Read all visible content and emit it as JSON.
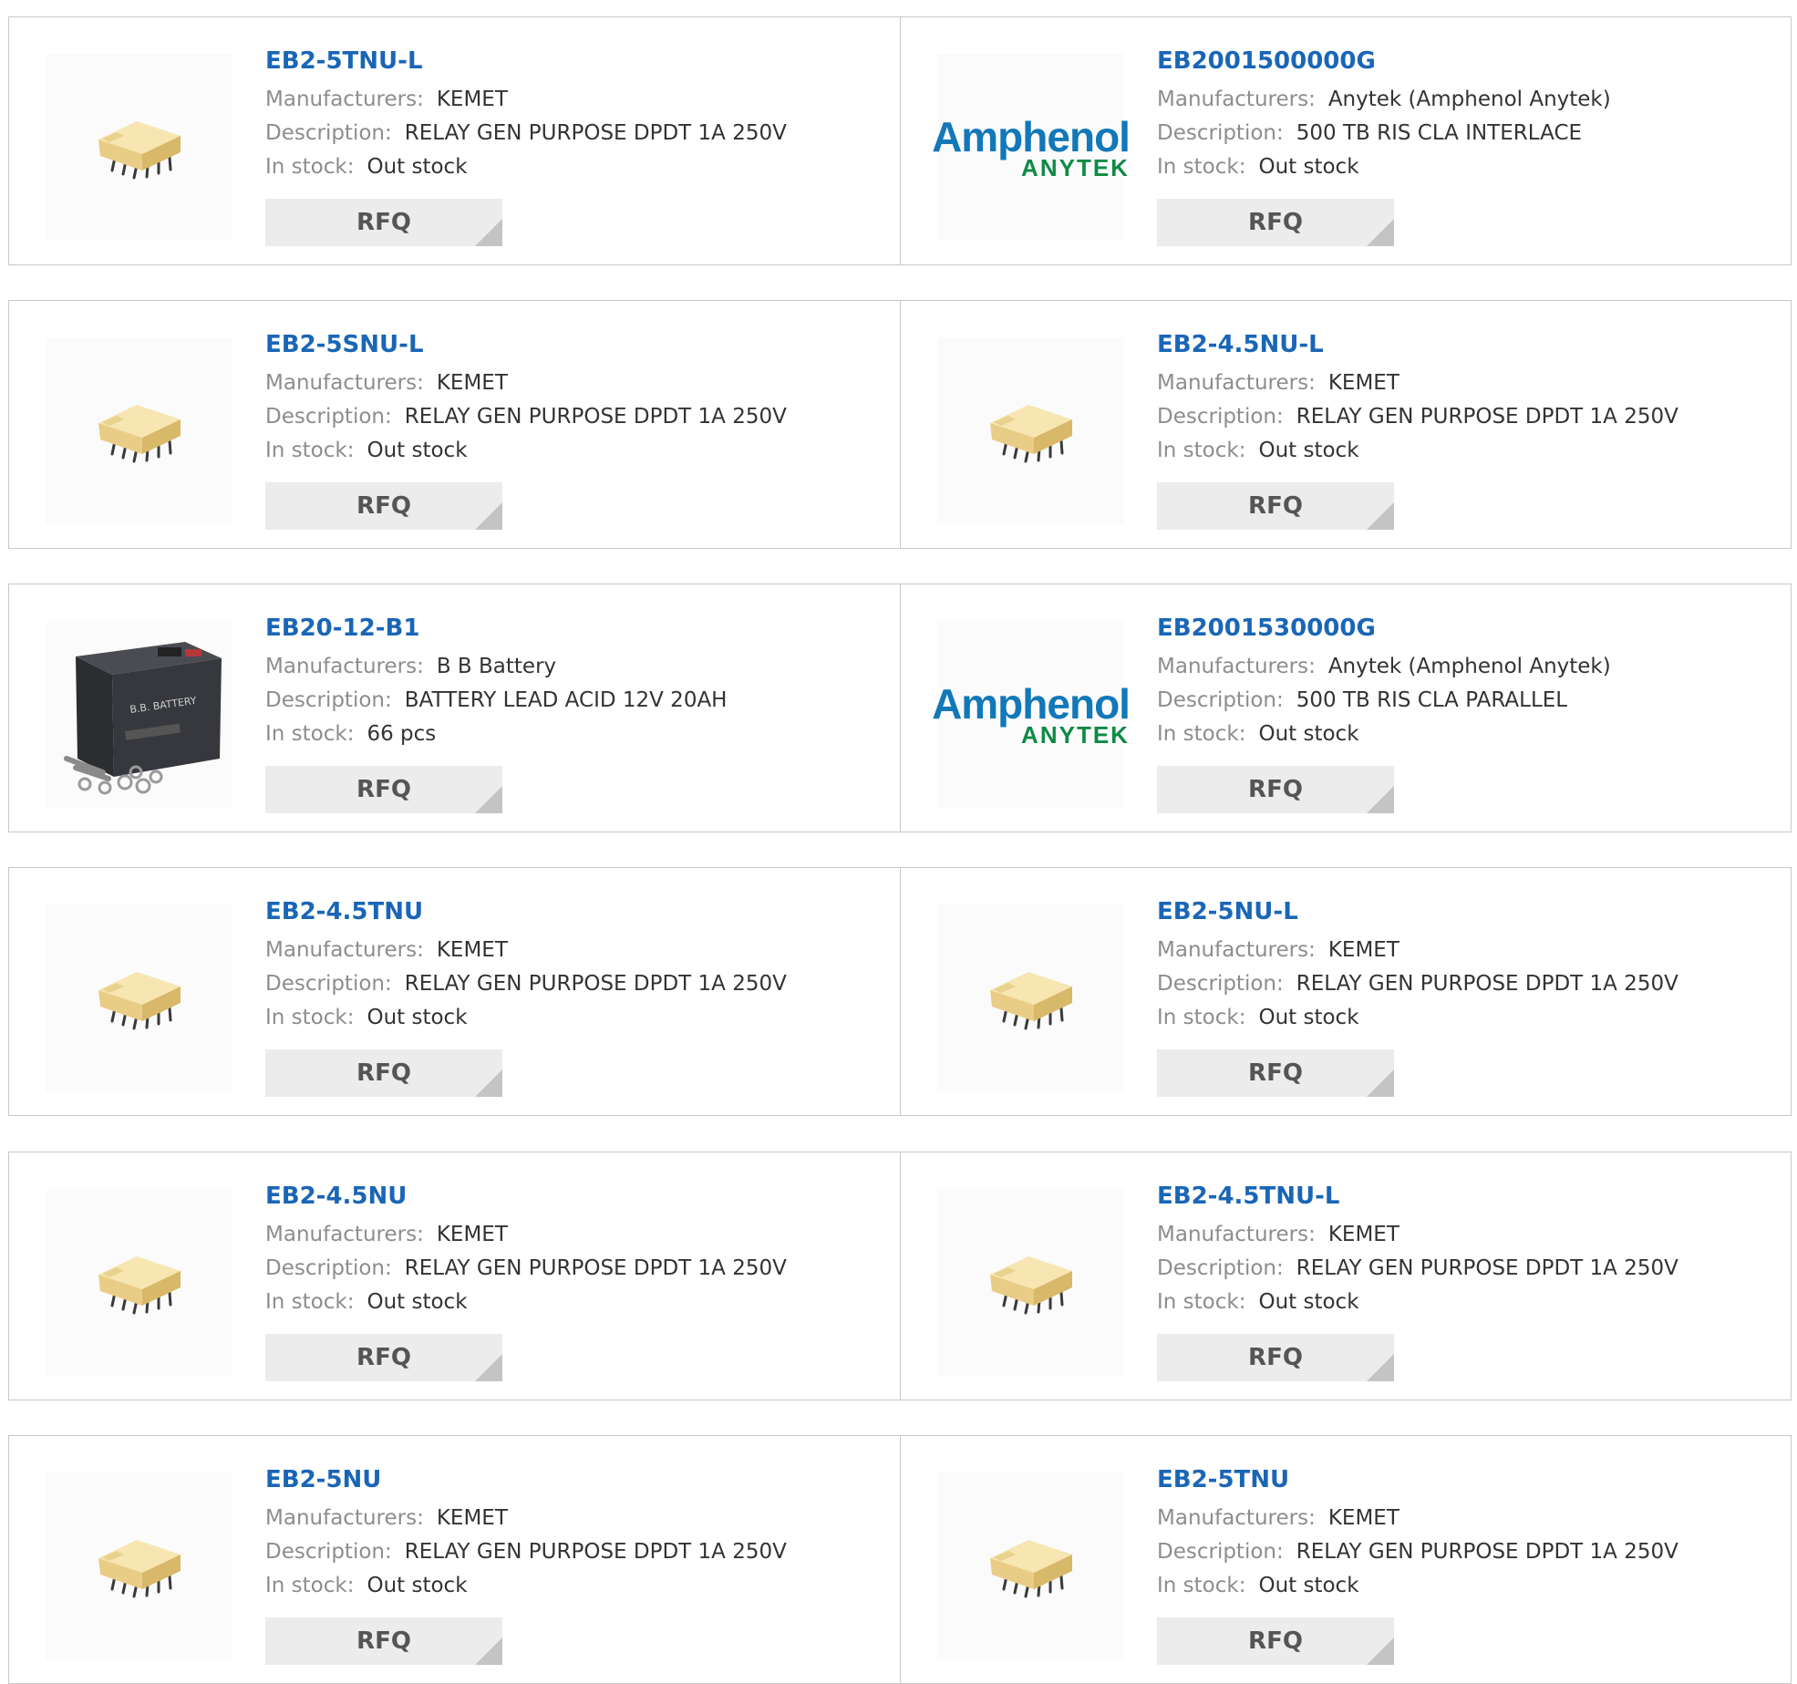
{
  "labels": {
    "manufacturer": "Manufacturers:",
    "description": "Description:",
    "stock": "In stock:",
    "rfq": "RFQ"
  },
  "brand": {
    "line1": "Amphenol",
    "line2": "ANYTEK"
  },
  "colors": {
    "link": "#1a66b6",
    "label": "#8d8d8d",
    "logo_blue": "#1278b8",
    "logo_green": "#0e8a45"
  },
  "products": [
    {
      "part": "EB2-5TNU-L",
      "manufacturer": "KEMET",
      "description": "RELAY GEN PURPOSE DPDT 1A 250V",
      "stock": "Out stock",
      "image": "relay-icon"
    },
    {
      "part": "EB2001500000G",
      "manufacturer": "Anytek (Amphenol Anytek)",
      "description": "500 TB RIS CLA INTERLACE",
      "stock": "Out stock",
      "image": "amphenol-logo"
    },
    {
      "part": "EB2-5SNU-L",
      "manufacturer": "KEMET",
      "description": "RELAY GEN PURPOSE DPDT 1A 250V",
      "stock": "Out stock",
      "image": "relay-icon"
    },
    {
      "part": "EB2-4.5NU-L",
      "manufacturer": "KEMET",
      "description": "RELAY GEN PURPOSE DPDT 1A 250V",
      "stock": "Out stock",
      "image": "relay-icon"
    },
    {
      "part": "EB20-12-B1",
      "manufacturer": "B B Battery",
      "description": "BATTERY LEAD ACID 12V 20AH",
      "stock": "66 pcs",
      "image": "battery-icon"
    },
    {
      "part": "EB2001530000G",
      "manufacturer": "Anytek (Amphenol Anytek)",
      "description": "500 TB RIS CLA PARALLEL",
      "stock": "Out stock",
      "image": "amphenol-logo"
    },
    {
      "part": "EB2-4.5TNU",
      "manufacturer": "KEMET",
      "description": "RELAY GEN PURPOSE DPDT 1A 250V",
      "stock": "Out stock",
      "image": "relay-icon"
    },
    {
      "part": "EB2-5NU-L",
      "manufacturer": "KEMET",
      "description": "RELAY GEN PURPOSE DPDT 1A 250V",
      "stock": "Out stock",
      "image": "relay-icon"
    },
    {
      "part": "EB2-4.5NU",
      "manufacturer": "KEMET",
      "description": "RELAY GEN PURPOSE DPDT 1A 250V",
      "stock": "Out stock",
      "image": "relay-icon"
    },
    {
      "part": "EB2-4.5TNU-L",
      "manufacturer": "KEMET",
      "description": "RELAY GEN PURPOSE DPDT 1A 250V",
      "stock": "Out stock",
      "image": "relay-icon"
    },
    {
      "part": "EB2-5NU",
      "manufacturer": "KEMET",
      "description": "RELAY GEN PURPOSE DPDT 1A 250V",
      "stock": "Out stock",
      "image": "relay-icon"
    },
    {
      "part": "EB2-5TNU",
      "manufacturer": "KEMET",
      "description": "RELAY GEN PURPOSE DPDT 1A 250V",
      "stock": "Out stock",
      "image": "relay-icon"
    }
  ]
}
